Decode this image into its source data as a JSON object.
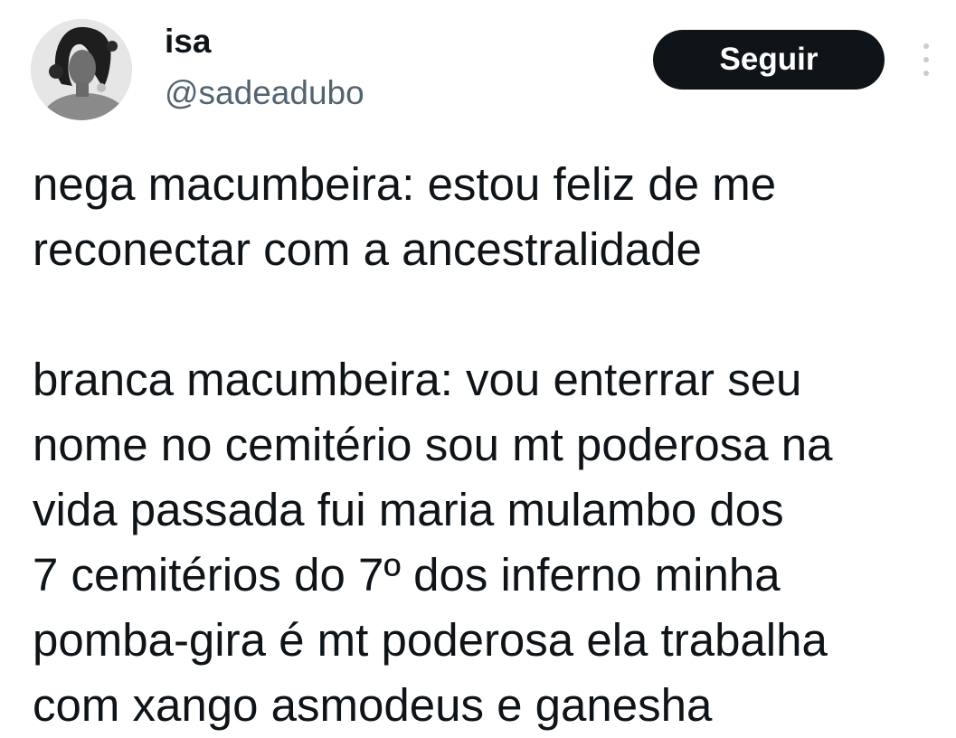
{
  "author": {
    "display_name": "isa",
    "handle": "@sadeadubo"
  },
  "actions": {
    "follow_label": "Seguir"
  },
  "tweet": {
    "paragraph1": [
      "nega macumbeira: estou feliz de me",
      "reconectar com a ancestralidade"
    ],
    "paragraph2": [
      "branca macumbeira: vou enterrar seu",
      "nome no cemitério sou mt poderosa na",
      "vida passada fui maria mulambo dos",
      "7 cemitérios do 7º dos inferno minha",
      "pomba-gira é mt poderosa ela trabalha",
      "com xango asmodeus e ganesha"
    ]
  },
  "colors": {
    "text": "#0f1419",
    "secondary": "#536471",
    "button_bg": "#0f1419",
    "button_text": "#ffffff"
  }
}
